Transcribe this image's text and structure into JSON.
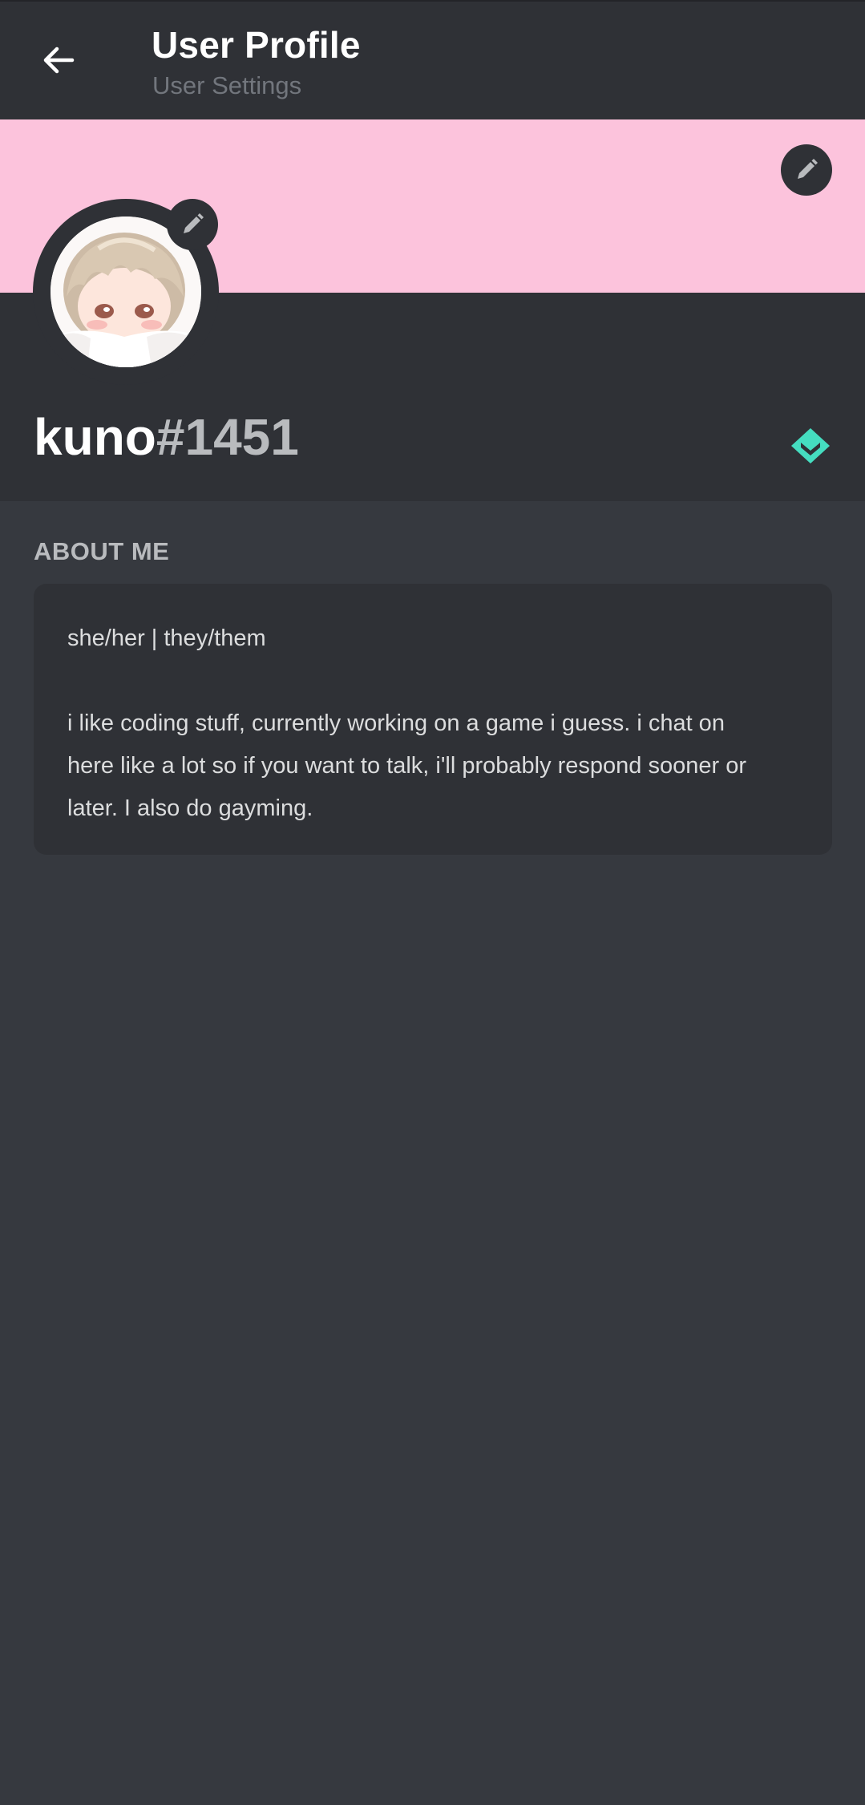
{
  "header": {
    "title": "User Profile",
    "subtitle": "User Settings",
    "back_icon": "arrow-left-icon"
  },
  "banner": {
    "color": "#fcc3dc",
    "edit_icon": "pencil-icon"
  },
  "profile": {
    "username": "kuno",
    "discriminator": "#1451",
    "avatar_edit_icon": "pencil-icon",
    "badge_icon": "hypesquad-balance-badge-icon",
    "badge_color": "#45ddc0"
  },
  "about": {
    "label": "ABOUT ME",
    "pronouns": "she/her | they/them",
    "bio_line_1": "i like coding stuff, currently working on a game i guess. i chat on",
    "bio_line_2": "here like a lot so if you want to talk, i'll probably respond sooner or",
    "bio_line_3": "later. I also do gayming."
  },
  "colors": {
    "background": "#36393f",
    "surface": "#2f3136",
    "text_primary": "#ffffff",
    "text_muted": "#b9bbbe"
  }
}
